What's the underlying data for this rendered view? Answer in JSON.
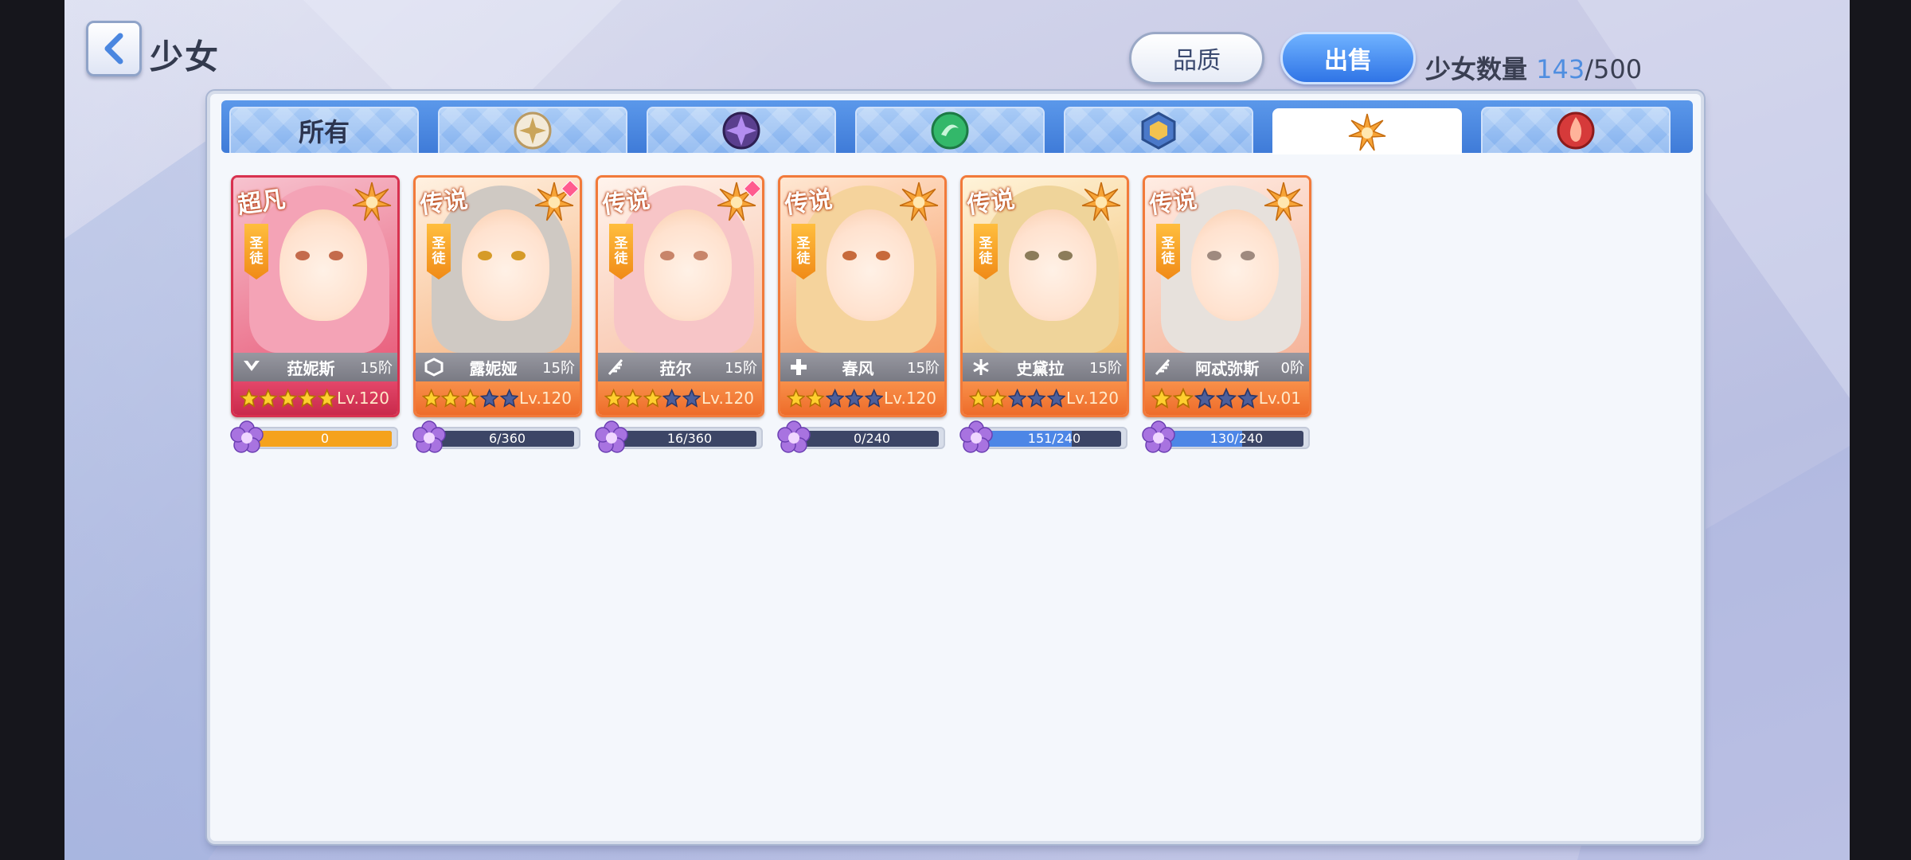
{
  "header": {
    "title": "少女",
    "quality_label": "品质",
    "sell_label": "出售",
    "count_label": "少女数量",
    "count_current": "143",
    "count_sep": "/",
    "count_max": "500"
  },
  "tabs": [
    {
      "label": "所有",
      "icon": null,
      "active": false
    },
    {
      "label": "",
      "icon": "light-element-icon",
      "active": false
    },
    {
      "label": "",
      "icon": "dark-element-icon",
      "active": false
    },
    {
      "label": "",
      "icon": "wind-element-icon",
      "active": false
    },
    {
      "label": "",
      "icon": "earth-element-icon",
      "active": false
    },
    {
      "label": "",
      "icon": "holy-element-icon",
      "active": true
    },
    {
      "label": "",
      "icon": "fire-element-icon",
      "active": false
    }
  ],
  "cards": [
    {
      "rarity": "超凡",
      "class": "圣徒",
      "name": "菈妮斯",
      "stage": "15阶",
      "stars": 5,
      "level": "Lv.120",
      "shard": "0",
      "shard_fill": 1.0,
      "gem": false,
      "role_icon": "wing-icon",
      "super": true
    },
    {
      "rarity": "传说",
      "class": "圣徒",
      "name": "露妮娅",
      "stage": "15阶",
      "stars": 3,
      "level": "Lv.120",
      "shard": "6/360",
      "shard_fill": 0.0,
      "gem": true,
      "role_icon": "shield-icon",
      "super": false
    },
    {
      "rarity": "传说",
      "class": "圣徒",
      "name": "菈尔",
      "stage": "15阶",
      "stars": 3,
      "level": "Lv.120",
      "shard": "16/360",
      "shard_fill": 0.0,
      "gem": true,
      "role_icon": "feather-icon",
      "super": false
    },
    {
      "rarity": "传说",
      "class": "圣徒",
      "name": "春风",
      "stage": "15阶",
      "stars": 2,
      "level": "Lv.120",
      "shard": "0/240",
      "shard_fill": 0.0,
      "gem": false,
      "role_icon": "cross-icon",
      "super": false
    },
    {
      "rarity": "传说",
      "class": "圣徒",
      "name": "史黛拉",
      "stage": "15阶",
      "stars": 2,
      "level": "Lv.120",
      "shard": "151/240",
      "shard_fill": 0.63,
      "gem": false,
      "role_icon": "snowflake-icon",
      "super": false
    },
    {
      "rarity": "传说",
      "class": "圣徒",
      "name": "阿忒弥斯",
      "stage": "0阶",
      "stars": 2,
      "level": "Lv.01",
      "shard": "130/240",
      "shard_fill": 0.54,
      "gem": false,
      "role_icon": "feather-icon",
      "super": false
    }
  ],
  "colors": {
    "accent_blue": "#3f7bd8",
    "legend_orange": "#f27a3a",
    "super_red": "#d8314f",
    "shard_blue": "#4d86e6",
    "shard_orange": "#f5a21c"
  }
}
